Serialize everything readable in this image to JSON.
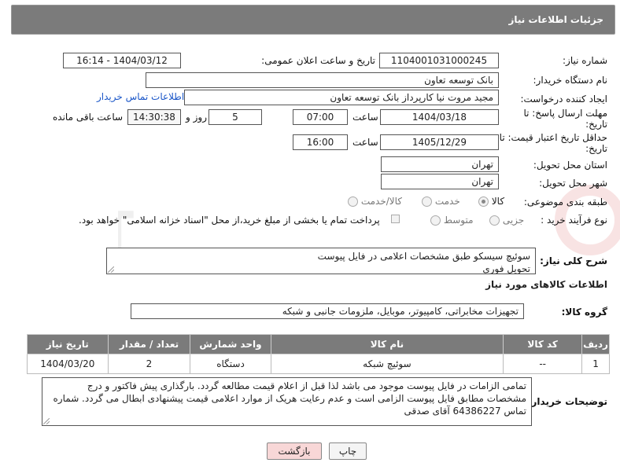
{
  "header": {
    "title": "جزئیات اطلاعات نیاز"
  },
  "fields": {
    "need_number_label": "شماره نیاز:",
    "need_number": "1104001031000245",
    "announce_label": "تاریخ و ساعت اعلان عمومی:",
    "announce_value": "1404/03/12 - 16:14",
    "buyer_org_label": "نام دستگاه خریدار:",
    "buyer_org": "بانک توسعه تعاون",
    "creator_label": "ایجاد کننده درخواست:",
    "creator": "مجید مروت نیا کارپرداز بانک توسعه تعاون",
    "contact_link": "اطلاعات تماس خریدار",
    "deadline_label": "مهلت ارسال پاسخ: تا تاریخ:",
    "deadline_date": "1404/03/18",
    "time_word": "ساعت",
    "deadline_time": "07:00",
    "days": "5",
    "days_word": "روز و",
    "remaining_time": "14:30:38",
    "remaining_word": "ساعت باقی مانده",
    "validity_label": "حداقل تاریخ اعتبار قیمت: تا تاریخ:",
    "validity_date": "1405/12/29",
    "validity_time": "16:00",
    "province_label": "استان محل تحویل:",
    "province": "تهران",
    "city_label": "شهر محل تحویل:",
    "city": "تهران",
    "category_label": "طبقه بندی موضوعی:",
    "category_options": [
      "کالا",
      "خدمت",
      "کالا/خدمت"
    ],
    "category_selected": "کالا",
    "process_label": "نوع فرآیند خرید :",
    "process_options": [
      "جزیی",
      "متوسط"
    ],
    "payment_note": "پرداخت تمام یا بخشی از مبلغ خرید،از محل \"اسناد خزانه اسلامی\" خواهد بود."
  },
  "description": {
    "label": "شرح کلی نیاز:",
    "text": "سوئیچ سیسکو طبق مشخصات اعلامی در فایل پیوست\nتحویل فوری"
  },
  "goods_info": {
    "heading": "اطلاعات کالاهای مورد نیاز",
    "group_label": "گروه کالا:",
    "group_value": "تجهیزات مخابراتی، کامپیوتر، موبایل، ملزومات جانبی و شبکه"
  },
  "table": {
    "headers": [
      "ردیف",
      "کد کالا",
      "نام کالا",
      "واحد شمارش",
      "تعداد / مقدار",
      "تاریخ نیاز"
    ],
    "rows": [
      [
        "1",
        "--",
        "سوئیچ شبکه",
        "دستگاه",
        "2",
        "1404/03/20"
      ]
    ]
  },
  "buyer_notes": {
    "label": "توضیحات خریدار:",
    "text": "تمامی الزامات در فایل پیوست موجود می باشد لذا قبل از اعلام قیمت مطالعه گردد. بارگذاری پیش فاکتور و درج مشخصات مطابق فایل پیوست الزامی است و عدم رعایت هریک از موارد اعلامی قیمت پیشنهادی ابطال می گردد. شماره تماس 64386227 آقای صدقی"
  },
  "buttons": {
    "print": "چاپ",
    "back": "بازگشت"
  },
  "watermark_text": "AriaTender.neT",
  "colors": {
    "header_bg": "#7b7b7b",
    "link": "#1a56c8",
    "back_bg": "#f8d7d7"
  }
}
